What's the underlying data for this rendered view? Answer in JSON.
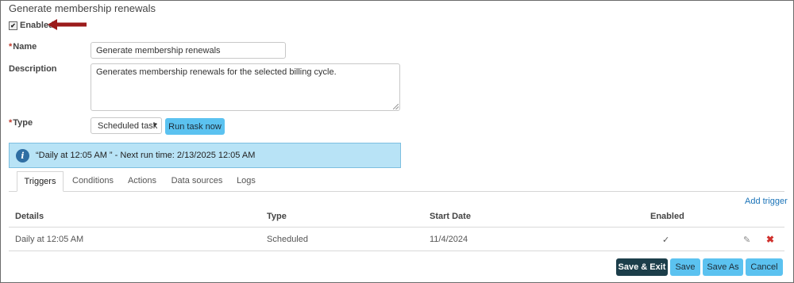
{
  "page": {
    "title": "Generate membership renewals"
  },
  "form": {
    "enabled_label": "Enabled",
    "enabled_checked": true,
    "name_label": "Name",
    "name_value": "Generate membership renewals",
    "description_label": "Description",
    "description_value": "Generates membership renewals for the selected billing cycle.",
    "type_label": "Type",
    "type_value": "Scheduled task",
    "run_task_label": "Run task now",
    "required_marker": "*"
  },
  "info": {
    "icon": "info-icon",
    "text": "“Daily at 12:05 AM ” - Next run time: 2/13/2025 12:05 AM"
  },
  "tabs": [
    {
      "label": "Triggers",
      "active": true
    },
    {
      "label": "Conditions",
      "active": false
    },
    {
      "label": "Actions",
      "active": false
    },
    {
      "label": "Data sources",
      "active": false
    },
    {
      "label": "Logs",
      "active": false
    }
  ],
  "triggers": {
    "add_label": "Add trigger",
    "columns": [
      "Details",
      "Type",
      "Start Date",
      "Enabled"
    ],
    "rows": [
      {
        "details": "Daily at 12:05 AM",
        "type": "Scheduled",
        "start_date": "11/4/2024",
        "enabled": "✓"
      }
    ]
  },
  "footer": {
    "save_exit": "Save & Exit",
    "save": "Save",
    "save_as": "Save As",
    "cancel": "Cancel"
  },
  "colors": {
    "accent": "#5bc2f0",
    "primary_button": "#1c3e4a",
    "info_bg": "#b8e3f6",
    "delete": "#d0312d",
    "arrow": "#9b1b1b"
  }
}
